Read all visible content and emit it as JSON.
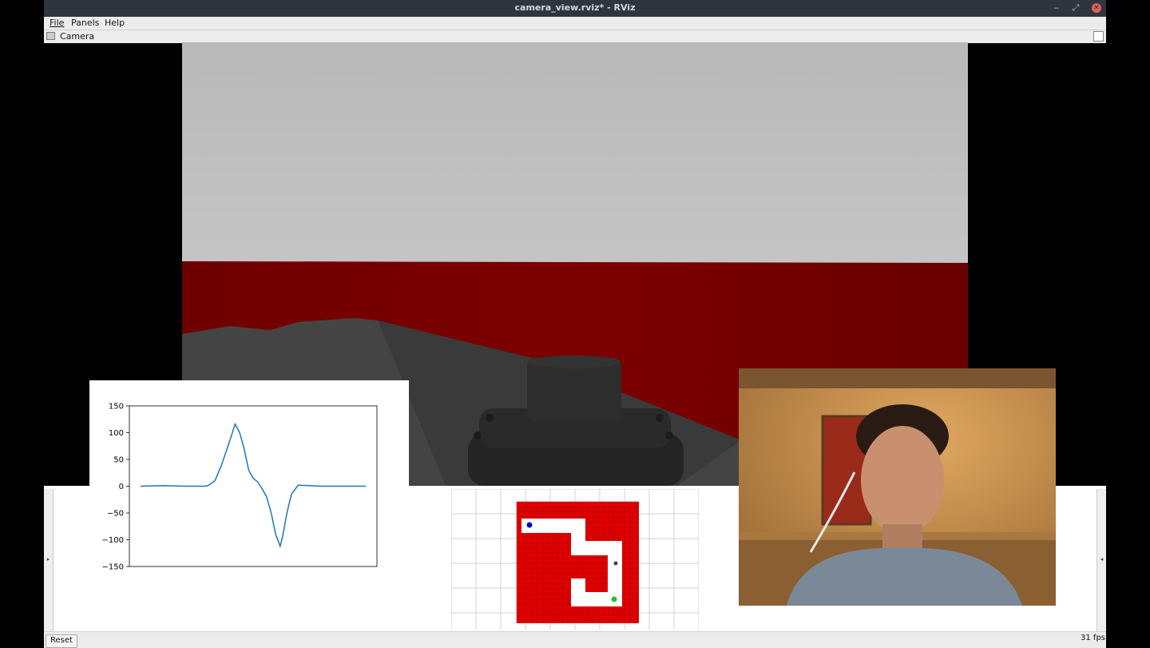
{
  "window": {
    "title": "camera_view.rviz* - RViz",
    "min": "‒",
    "max": "⤢",
    "close": "✕"
  },
  "menu": {
    "file": "File",
    "panels": "Panels",
    "help": "Help"
  },
  "panel": {
    "title": "Camera"
  },
  "status": {
    "reset": "Reset",
    "fps": "31 fps"
  },
  "gutters": {
    "left": "▸",
    "right": "◂"
  },
  "colors": {
    "wall": "#7a0000",
    "occupied_cell": "#e00000",
    "robot": "#0010c0",
    "goal": "#22c030",
    "titlebar": "#2f343f",
    "plot_line": "#1f77b4"
  },
  "chart_data": {
    "type": "line",
    "title": "",
    "xlabel": "",
    "ylabel": "",
    "ylim": [
      -150,
      150
    ],
    "yticks": [
      150,
      100,
      50,
      0,
      -50,
      -100,
      -150
    ],
    "xlim": [
      0,
      100
    ],
    "series": [
      {
        "x": [
          0,
          10,
          20,
          28,
          30,
          33,
          36,
          40,
          42,
          44,
          46,
          48,
          50,
          52,
          54,
          56,
          58,
          60,
          62,
          63,
          65,
          67,
          70,
          75,
          80,
          90,
          100
        ],
        "y": [
          0,
          1,
          0,
          0,
          1,
          10,
          40,
          90,
          116,
          100,
          70,
          30,
          15,
          8,
          -5,
          -20,
          -50,
          -90,
          -112,
          -95,
          -50,
          -15,
          2,
          1,
          0,
          0,
          0
        ]
      }
    ]
  }
}
